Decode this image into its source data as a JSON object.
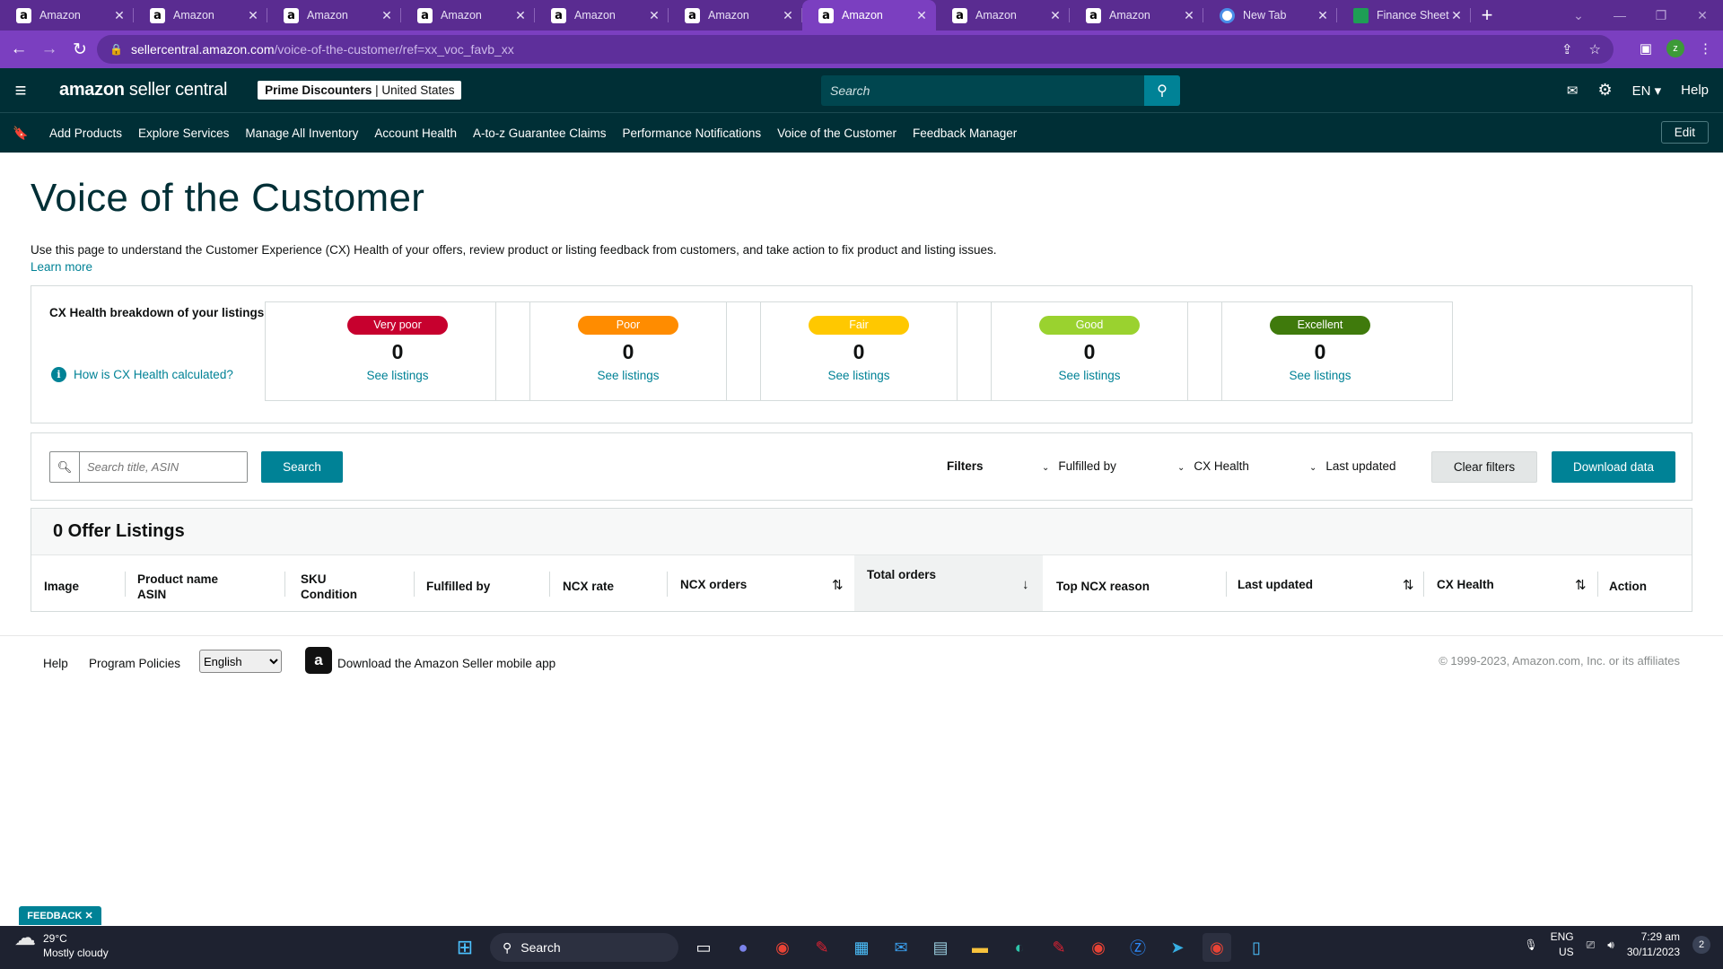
{
  "browser": {
    "tabs": [
      {
        "title": "Amazon",
        "icon": "amazon-a",
        "active": false
      },
      {
        "title": "Amazon",
        "icon": "amazon-a",
        "active": false
      },
      {
        "title": "Amazon",
        "icon": "amazon-a",
        "active": false
      },
      {
        "title": "Amazon",
        "icon": "amazon-a",
        "active": false
      },
      {
        "title": "Amazon",
        "icon": "amazon-a",
        "active": false
      },
      {
        "title": "Amazon",
        "icon": "amazon-a",
        "active": false
      },
      {
        "title": "Amazon",
        "icon": "amazon-a",
        "active": true
      },
      {
        "title": "Amazon",
        "icon": "amazon-a",
        "active": false
      },
      {
        "title": "Amazon",
        "icon": "amazon-a",
        "active": false
      },
      {
        "title": "New Tab",
        "icon": "chrome",
        "active": false
      },
      {
        "title": "Finance Sheet",
        "icon": "sheets",
        "active": false
      }
    ],
    "url_host": "sellercentral.amazon.com",
    "url_path": "/voice-of-the-customer/ref=xx_voc_favb_xx",
    "profile_initial": "z"
  },
  "header": {
    "logo_main": "amazon",
    "logo_rest": " seller central",
    "account_name": "Prime Discounters",
    "account_region": "United States",
    "search_placeholder": "Search",
    "language": "EN",
    "help": "Help"
  },
  "nav": {
    "items": [
      "Add Products",
      "Explore Services",
      "Manage All Inventory",
      "Account Health",
      "A-to-z Guarantee Claims",
      "Performance Notifications",
      "Voice of the Customer",
      "Feedback Manager"
    ],
    "edit": "Edit"
  },
  "page": {
    "title": "Voice of the Customer",
    "description": "Use this page to understand the Customer Experience (CX) Health of your offers, review product or listing feedback from customers, and take action to fix product and listing issues.",
    "learn_more": "Learn more"
  },
  "cx_health": {
    "title": "CX Health breakdown of your listings",
    "how_link": "How is CX Health calculated?",
    "cards": [
      {
        "label": "Very poor",
        "count": "0",
        "link": "See listings",
        "color": "#c7002e"
      },
      {
        "label": "Poor",
        "count": "0",
        "link": "See listings",
        "color": "#ff8c00"
      },
      {
        "label": "Fair",
        "count": "0",
        "link": "See listings",
        "color": "#ffc800"
      },
      {
        "label": "Good",
        "count": "0",
        "link": "See listings",
        "color": "#9ad22f"
      },
      {
        "label": "Excellent",
        "count": "0",
        "link": "See listings",
        "color": "#3f7a0c"
      }
    ]
  },
  "filters": {
    "search_placeholder": "Search title, ASIN",
    "search_button": "Search",
    "label": "Filters",
    "fulfilled_by": "Fulfilled by",
    "cx_health": "CX Health",
    "last_updated": "Last updated",
    "clear": "Clear filters",
    "download": "Download data"
  },
  "listings": {
    "heading": "0 Offer Listings",
    "columns": {
      "image": "Image",
      "product_name": "Product name",
      "asin": "ASIN",
      "sku": "SKU",
      "condition": "Condition",
      "fulfilled_by": "Fulfilled by",
      "ncx_rate": "NCX rate",
      "ncx_orders": "NCX orders",
      "total_orders": "Total orders",
      "top_ncx_reason": "Top NCX reason",
      "last_updated": "Last updated",
      "cx_health": "CX Health",
      "action": "Action"
    }
  },
  "footer": {
    "help": "Help",
    "policies": "Program Policies",
    "language": "English",
    "app_text": "Download the Amazon Seller mobile app",
    "copyright": "© 1999-2023, Amazon.com, Inc. or its affiliates"
  },
  "feedback_tab": "FEEDBACK",
  "taskbar": {
    "temp": "29°C",
    "weather": "Mostly cloudy",
    "search": "Search",
    "lang_top": "ENG",
    "lang_bottom": "US",
    "time": "7:29 am",
    "date": "30/11/2023",
    "notifications": "2"
  }
}
